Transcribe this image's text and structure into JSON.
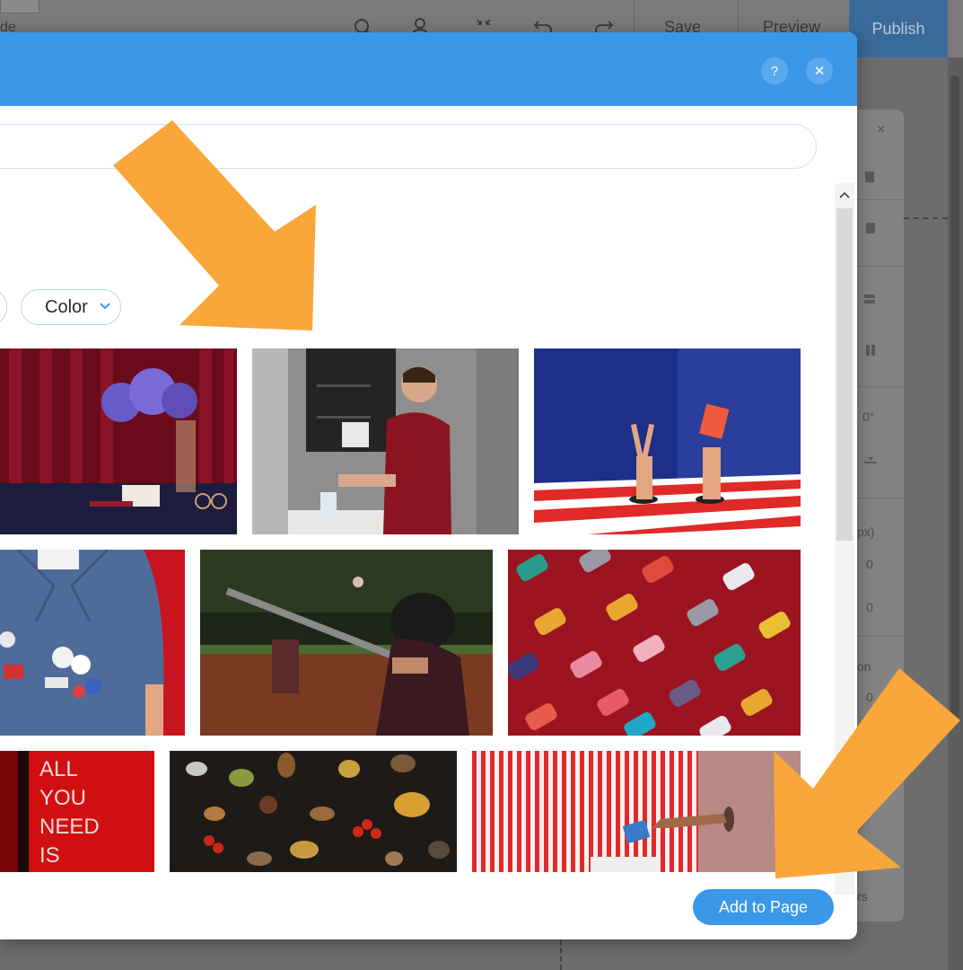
{
  "topbar": {
    "left_fragment": "de",
    "save_label": "Save",
    "preview_label": "Preview",
    "publish_label": "Publish",
    "icons": [
      "search-icon",
      "user-icon",
      "zoom-fit-icon",
      "undo-icon",
      "redo-icon"
    ]
  },
  "modal": {
    "header_buttons": {
      "help": "?",
      "close": "✕"
    },
    "search": {
      "value": "",
      "placeholder": ""
    },
    "filters": {
      "color_label": "Color",
      "chevron": "⌄"
    },
    "photos": [
      {
        "name": "purple-flowers-vase-red-curtain"
      },
      {
        "name": "boy-washing-hands"
      },
      {
        "name": "peace-sign-hands-striped-floor"
      },
      {
        "name": "man-denim-shirt-pins"
      },
      {
        "name": "baseball-batter"
      },
      {
        "name": "colorful-hair-clips-red"
      },
      {
        "name": "neon-sign-all-you-need",
        "sign_text": [
          "ALL",
          "YOU",
          "NEED",
          "IS"
        ]
      },
      {
        "name": "autumn-leaves-flatlay"
      },
      {
        "name": "hand-card-striped-wall"
      }
    ],
    "add_button_label": "Add to Page"
  },
  "side_panel": {
    "close": "×",
    "degree": "0°",
    "px": "px)",
    "v1": "0",
    "v2": "0",
    "on": "on",
    "v3": "0",
    "rs": "rs"
  },
  "colors": {
    "header_blue": "#3b97e8",
    "arrow_orange": "#f9a63a",
    "publish_bg": "#3a6a9a"
  }
}
